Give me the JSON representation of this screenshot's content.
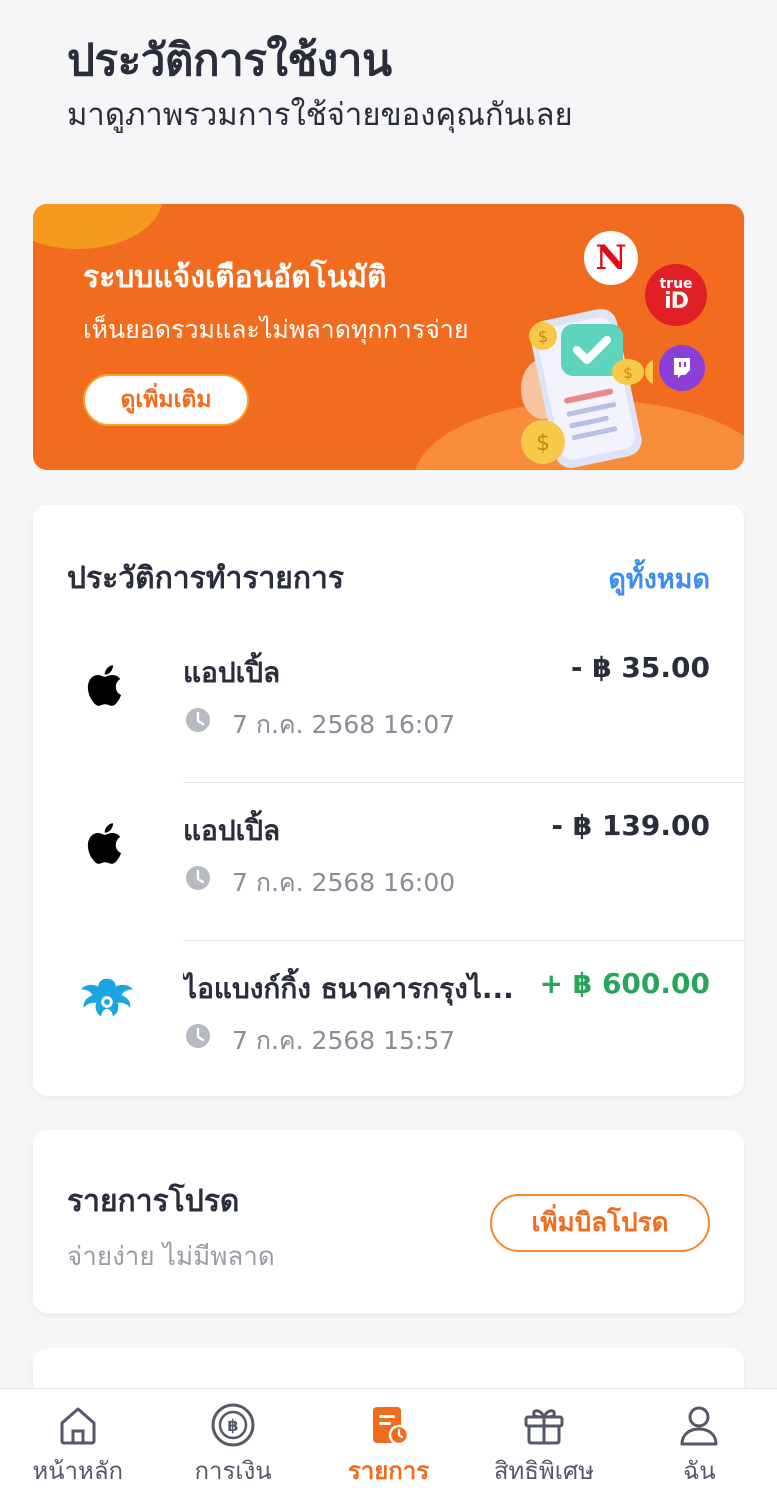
{
  "header": {
    "title": "ประวัติการใช้งาน",
    "subtitle": "มาดูภาพรวมการใช้จ่ายของคุณกันเลย"
  },
  "banner": {
    "title": "ระบบแจ้งเตือนอัตโนมัติ",
    "text": "เห็นยอดรวมและไม่พลาดทุกการจ่าย",
    "button_label": "ดูเพิ่มเติม",
    "brands": {
      "netflix": "N",
      "trueid_top": "true",
      "trueid_bottom": "iD"
    },
    "color": "#f26c1f"
  },
  "history": {
    "title": "ประวัติการทำรายการ",
    "see_all": "ดูทั้งหมด",
    "transactions": [
      {
        "merchant": "แอปเปิ้ล",
        "amount": "- ฿ 35.00",
        "datetime": "7 ก.ค. 2568 16:07",
        "icon": "apple-icon"
      },
      {
        "merchant": "แอปเปิ้ล",
        "amount": "- ฿ 139.00",
        "datetime": "7 ก.ค. 2568 16:00",
        "icon": "apple-icon"
      },
      {
        "merchant": "ไอแบงก์กิ้ง ธนาคารกรุงไ...",
        "amount": "+ ฿ 600.00",
        "datetime": "7 ก.ค. 2568 15:57",
        "icon": "krungthai-bank-icon"
      }
    ],
    "positive_color": "#27a55a"
  },
  "bills": {
    "title": "รายการโปรด",
    "subtitle": "จ่ายง่าย ไม่มีพลาด",
    "add_button": "เพิ่มบิลโปรด"
  },
  "bottom_nav": {
    "items": [
      {
        "label": "หน้าหลัก",
        "icon": "home-icon"
      },
      {
        "label": "การเงิน",
        "icon": "baht-coin-icon"
      },
      {
        "label": "รายการ",
        "icon": "receipt-icon"
      },
      {
        "label": "สิทธิพิเศษ",
        "icon": "gift-icon"
      },
      {
        "label": "ฉัน",
        "icon": "profile-icon"
      }
    ],
    "active_index": 2,
    "active_color": "#f26c1f"
  }
}
